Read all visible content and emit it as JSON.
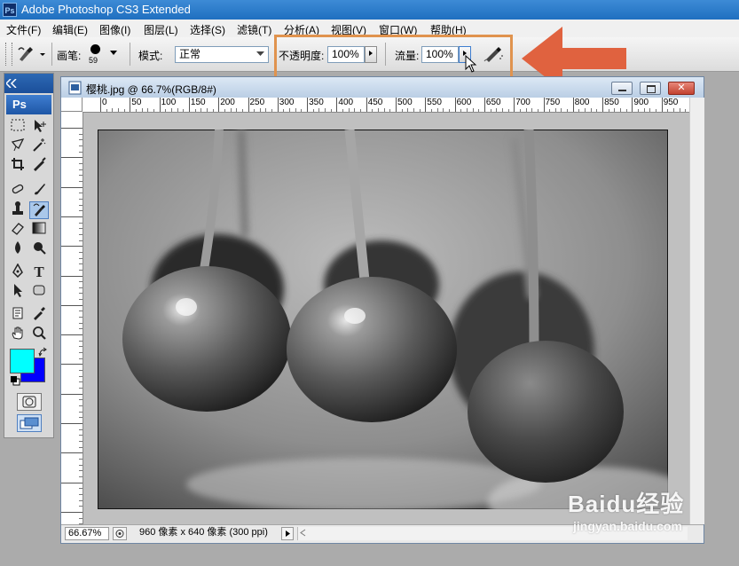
{
  "app": {
    "title": "Adobe Photoshop CS3 Extended",
    "logo_text": "Ps"
  },
  "menu": [
    "文件(F)",
    "编辑(E)",
    "图像(I)",
    "图层(L)",
    "选择(S)",
    "滤镜(T)",
    "分析(A)",
    "视图(V)",
    "窗口(W)",
    "帮助(H)"
  ],
  "options": {
    "tool_icon": "history-brush-icon",
    "brush_label": "画笔:",
    "brush_size": "59",
    "mode_label": "模式:",
    "mode_value": "正常",
    "opacity_label": "不透明度:",
    "opacity_value": "100%",
    "flow_label": "流量:",
    "flow_value": "100%",
    "airbrush_icon": "airbrush-icon"
  },
  "toolbox": {
    "logo": "Ps",
    "tools": [
      "marquee-icon",
      "move-icon",
      "lasso-icon",
      "magic-wand-icon",
      "crop-icon",
      "slice-icon",
      "healing-brush-icon",
      "brush-icon",
      "clone-stamp-icon",
      "history-brush-icon",
      "eraser-icon",
      "gradient-icon",
      "blur-icon",
      "dodge-icon",
      "pen-icon",
      "type-icon",
      "path-select-icon",
      "shape-icon",
      "notes-icon",
      "eyedropper-icon",
      "hand-icon",
      "zoom-icon"
    ],
    "foreground_color": "#00ffff",
    "background_color": "#0000ff"
  },
  "document": {
    "title": "樱桃.jpg @ 66.7%(RGB/8#)",
    "ruler_labels": [
      "0",
      "50",
      "100",
      "150",
      "200",
      "250",
      "300",
      "350",
      "400",
      "450",
      "500",
      "550",
      "600",
      "650",
      "700",
      "750",
      "800",
      "850",
      "900",
      "950"
    ],
    "status_zoom": "66.67%",
    "status_info": "960 像素 x 640 像素 (300 ppi)"
  },
  "annotation": {
    "highlight_color": "#e0934e",
    "arrow_color": "#e0623f"
  },
  "watermark": {
    "brand": "Baidu经验",
    "url": "jingyan.baidu.com"
  }
}
